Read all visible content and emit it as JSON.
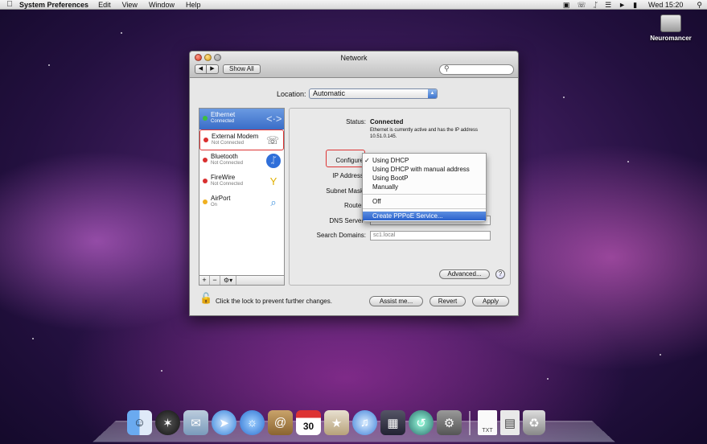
{
  "menubar": {
    "app": "System Preferences",
    "menus": [
      "Edit",
      "View",
      "Window",
      "Help"
    ],
    "clock": "Wed 15:20",
    "status_icons": [
      "script-menu-icon",
      "phone-icon",
      "bluetooth-icon",
      "wifi-icon",
      "volume-icon",
      "battery-icon",
      "spotlight-icon"
    ]
  },
  "desktop": {
    "hd_label": "Neuromancer"
  },
  "window": {
    "title": "Network",
    "show_all": "Show All",
    "search_placeholder": "",
    "location_label": "Location:",
    "location_value": "Automatic"
  },
  "services": [
    {
      "name": "Ethernet",
      "status": "Connected",
      "dot": "#3cbf3c",
      "icon": "ethernet-icon",
      "selected": true
    },
    {
      "name": "External Modem",
      "status": "Not Connected",
      "dot": "#d93030",
      "icon": "phone-icon",
      "highlighted": true
    },
    {
      "name": "Bluetooth",
      "status": "Not Connected",
      "dot": "#d93030",
      "icon": "bluetooth-icon"
    },
    {
      "name": "FireWire",
      "status": "Not Connected",
      "dot": "#d93030",
      "icon": "firewire-icon"
    },
    {
      "name": "AirPort",
      "status": "On",
      "dot": "#f0b020",
      "icon": "wifi-icon"
    }
  ],
  "detail": {
    "status_label": "Status:",
    "status_value": "Connected",
    "status_desc": "Ethernet is currently active and has the IP address 10.51.0.145.",
    "configure_label": "Configure",
    "ip_label": "IP Address",
    "subnet_label": "Subnet Mask",
    "router_label": "Router",
    "dns_label": "DNS Server",
    "search_domains_label": "Search Domains:",
    "search_domains_value": "sc1.local",
    "advanced": "Advanced...",
    "help": "?"
  },
  "dropdown": {
    "items": [
      {
        "label": "Using DHCP",
        "checked": true
      },
      {
        "label": "Using DHCP with manual address"
      },
      {
        "label": "Using BootP"
      },
      {
        "label": "Manually"
      },
      {
        "label": "Off"
      },
      {
        "label": "Create PPPoE Service...",
        "highlighted": true
      }
    ]
  },
  "footer": {
    "lock_text": "Click the lock to prevent further changes.",
    "assist": "Assist me...",
    "revert": "Revert",
    "apply": "Apply"
  },
  "dock": {
    "icon_labels": {
      "txt_doc": "TXT"
    },
    "calendar_day": "30"
  }
}
